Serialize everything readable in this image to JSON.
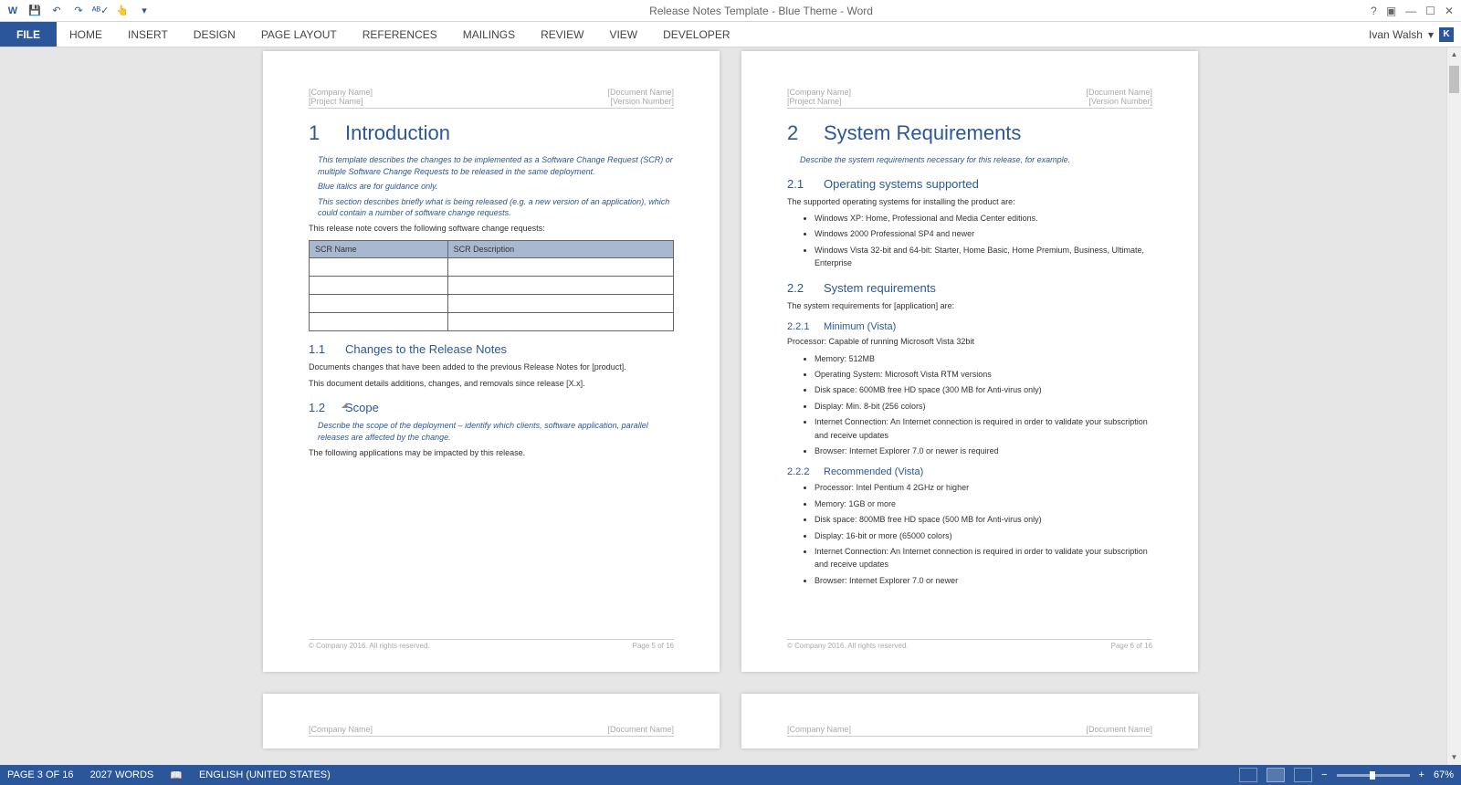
{
  "app": {
    "title": "Release Notes Template - Blue Theme - Word"
  },
  "qat": {
    "save": "💾",
    "undo": "↶",
    "redo": "↷",
    "spell": "ᴬᴮ✓",
    "touch": "👆"
  },
  "menu": {
    "file": "FILE",
    "tabs": [
      "HOME",
      "INSERT",
      "DESIGN",
      "PAGE LAYOUT",
      "REFERENCES",
      "MAILINGS",
      "REVIEW",
      "VIEW",
      "DEVELOPER"
    ],
    "user": "Ivan Walsh",
    "avatar": "K"
  },
  "winbtns": {
    "help": "?",
    "ribbon": "▣",
    "min": "—",
    "max": "☐",
    "close": "✕"
  },
  "docHeader": {
    "leftTop": "[Company Name]",
    "leftBottom": "[Project Name]",
    "rightTop": "[Document Name]",
    "rightBottom": "[Version Number]"
  },
  "page1": {
    "h1num": "1",
    "h1": "Introduction",
    "blue1": "This template describes the changes to be implemented as a Software Change Request (SCR) or multiple Software Change Requests to be released in the same deployment.",
    "blue2": "Blue italics are for guidance only.",
    "blue3": "This section describes briefly what is being released (e.g. a new version of an application), which could contain a number of software change requests.",
    "body1": "This release note covers the following software change requests:",
    "table": {
      "col1": "SCR Name",
      "col2": "SCR Description"
    },
    "s11num": "1.1",
    "s11": "Changes to the Release Notes",
    "s11body1": "Documents changes that have been added to the previous Release Notes for [product].",
    "s11body2": "This document details additions, changes, and removals since release [X.x].",
    "s12num": "1.2",
    "s12": "Scope",
    "s12blue": "Describe the scope of the deployment – identify which clients, software application, parallel releases are affected by the change.",
    "s12body": "The following applications may be impacted by this release.",
    "footerL": "© Company 2016. All rights reserved.",
    "footerR": "Page 5 of 16"
  },
  "page2": {
    "h1num": "2",
    "h1": "System Requirements",
    "blue1": "Describe the system requirements necessary for this release, for example.",
    "s21num": "2.1",
    "s21": "Operating systems supported",
    "s21body": "The supported operating systems for installing the product are:",
    "s21list": [
      "Windows XP: Home, Professional and Media Center editions.",
      "Windows 2000 Professional SP4 and newer",
      "Windows Vista 32-bit and 64-bit: Starter, Home Basic, Home Premium, Business, Ultimate, Enterprise"
    ],
    "s22num": "2.2",
    "s22": "System requirements",
    "s22body": "The system requirements for [application] are:",
    "s221num": "2.2.1",
    "s221": "Minimum (Vista)",
    "s221body": "Processor: Capable of running Microsoft Vista 32bit",
    "s221list": [
      "Memory: 512MB",
      "Operating System: Microsoft Vista RTM versions",
      "Disk space: 600MB free HD space (300 MB for Anti-virus only)",
      "Display: Min. 8-bit (256 colors)",
      "Internet Connection: An Internet connection is required in order to validate your subscription and receive updates",
      "Browser: Internet Explorer 7.0 or newer is required"
    ],
    "s222num": "2.2.2",
    "s222": "Recommended (Vista)",
    "s222list": [
      "Processor: Intel Pentium 4 2GHz or higher",
      "Memory: 1GB or more",
      "Disk space: 800MB free HD space  (500 MB for Anti-virus only)",
      "Display: 16-bit or more (65000 colors)",
      "Internet Connection: An Internet connection is required in order to validate your subscription and receive updates",
      "Browser: Internet Explorer 7.0 or newer"
    ],
    "footerL": "© Company 2016. All rights reserved.",
    "footerR": "Page 6 of 16"
  },
  "status": {
    "page": "PAGE 3 OF 16",
    "words": "2027 WORDS",
    "lang": "ENGLISH (UNITED STATES)",
    "zoom": "67%"
  }
}
